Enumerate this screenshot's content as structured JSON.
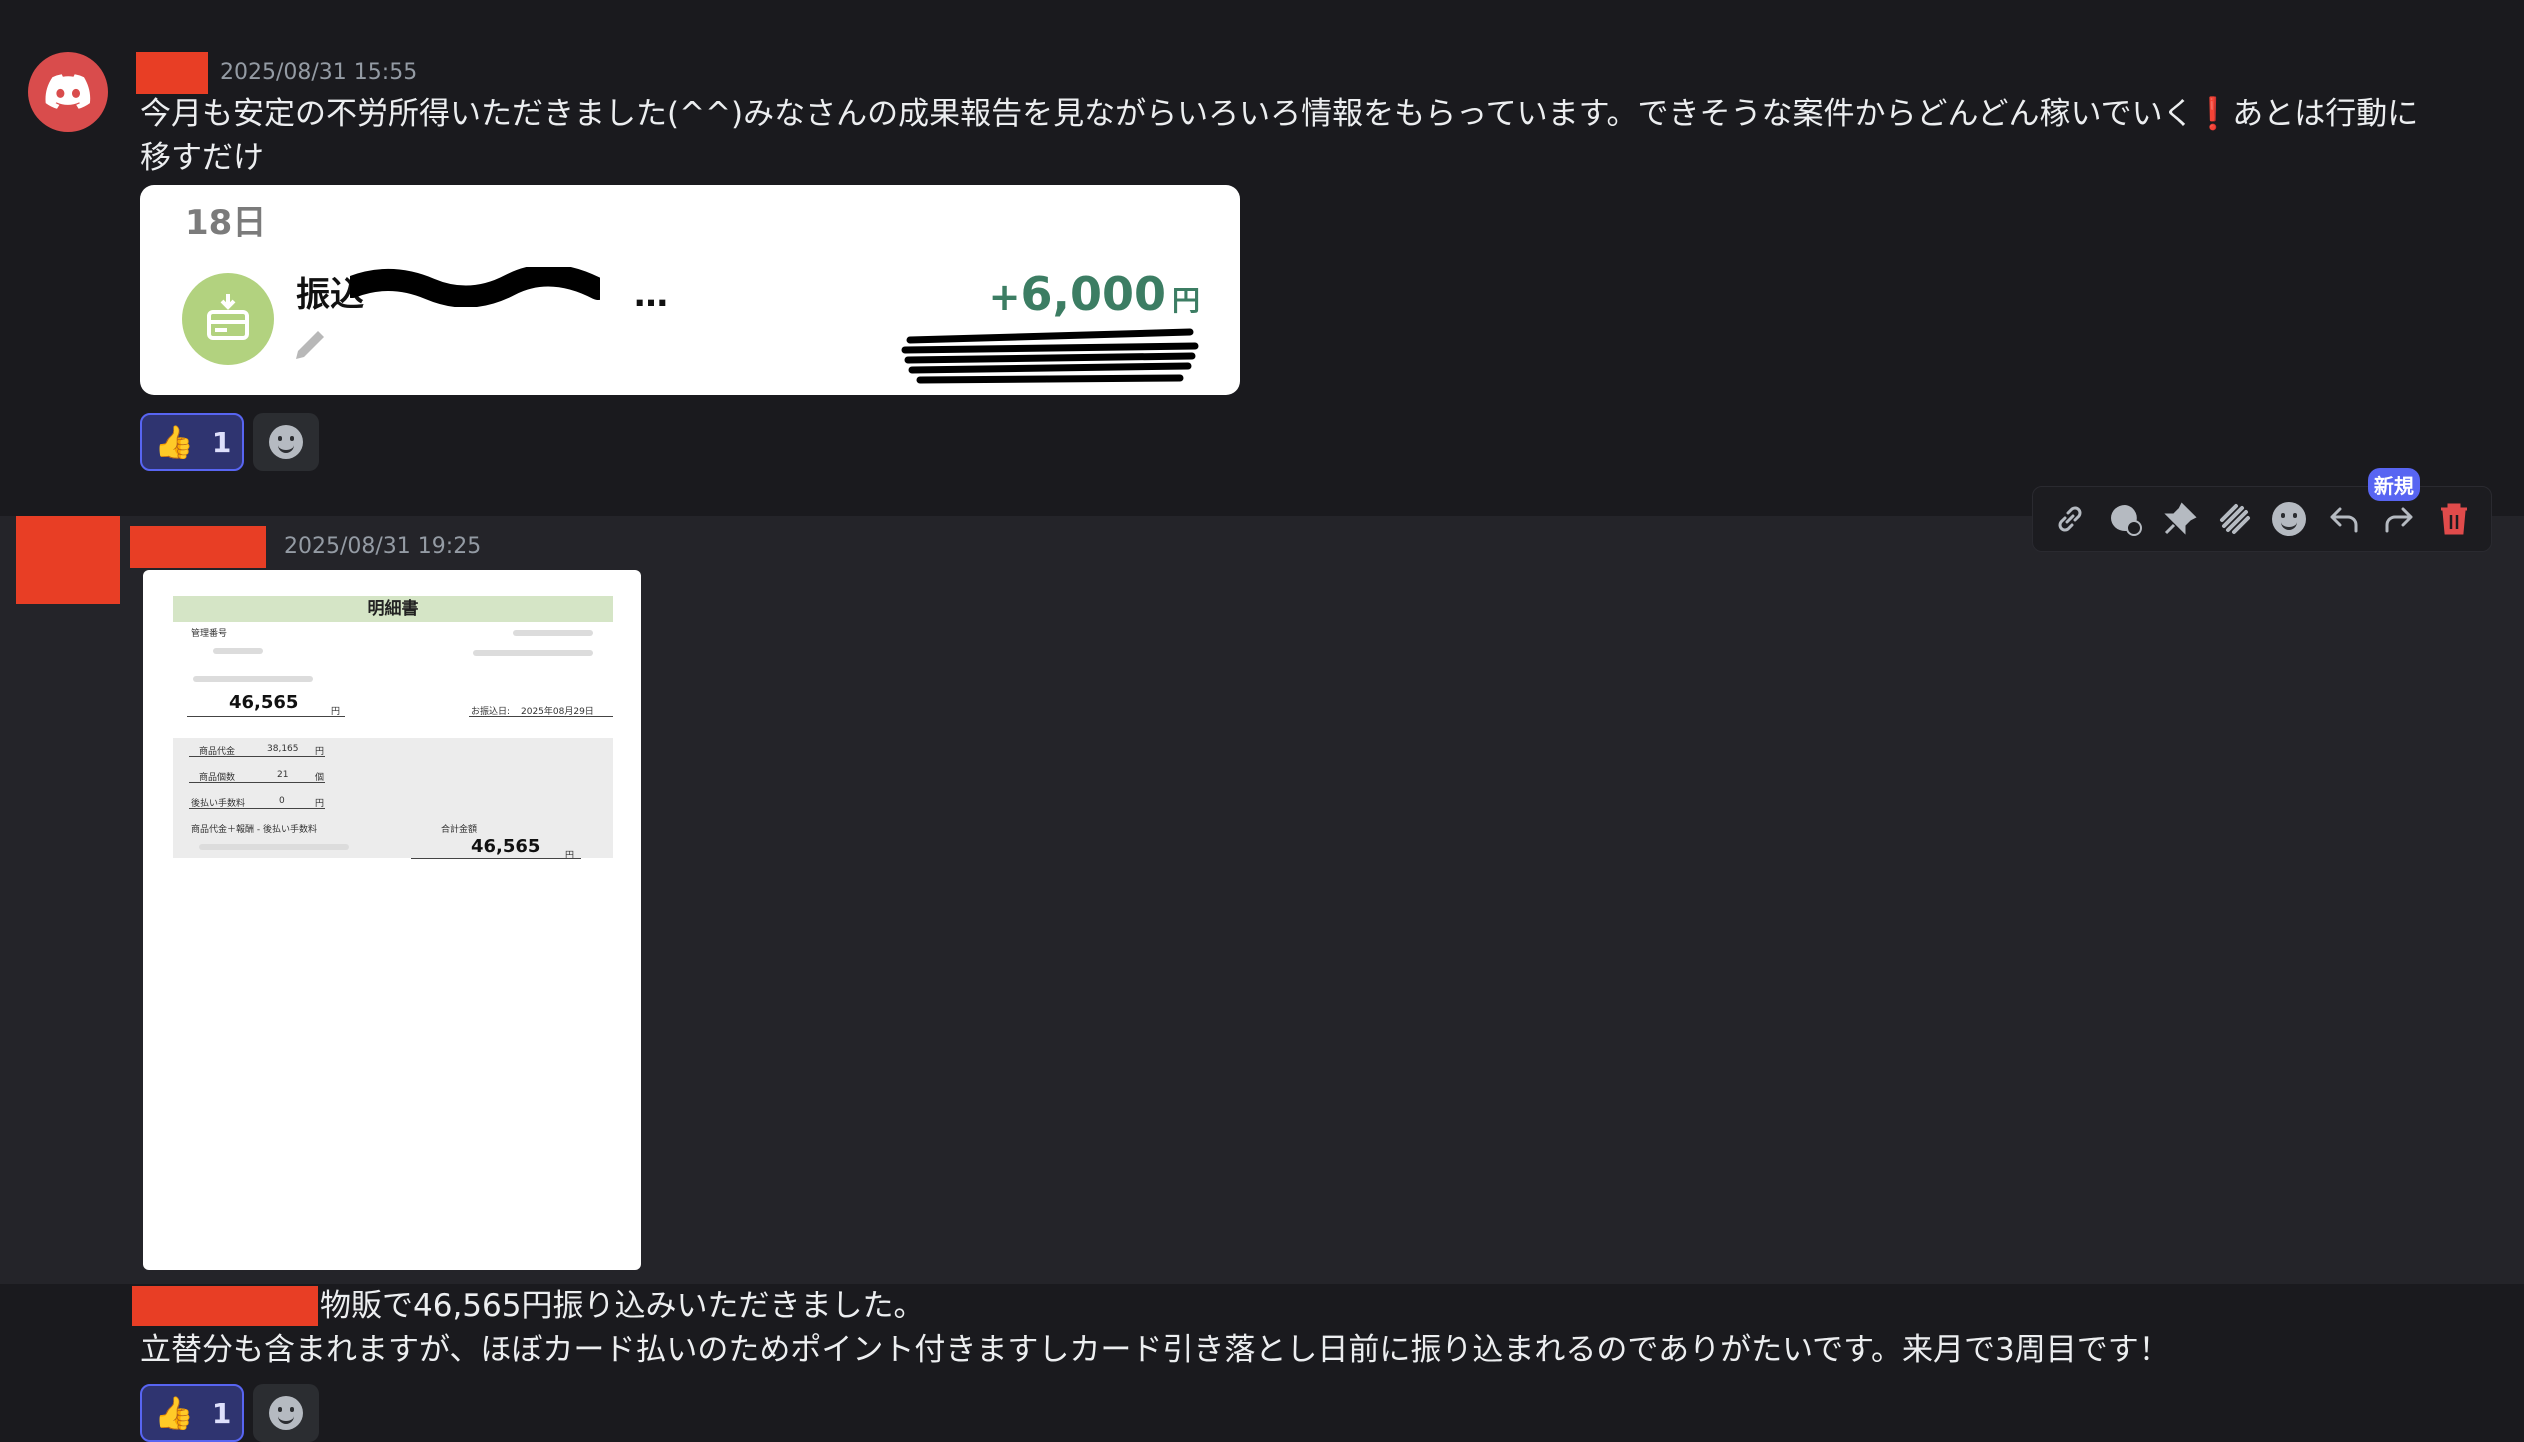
{
  "message1": {
    "timestamp": "2025/08/31 15:55",
    "text_part1": "今月も安定の不労所得いただきました(^^)みなさんの成果報告を見ながらいろいろ情報をもらっています。できそうな案件からどんどん稼いでいく",
    "exclamation": "❗",
    "text_part2": "あとは行動に",
    "text_line2": "移すだけ",
    "card": {
      "day": "18日",
      "title_visible": "振込",
      "title_trail": "…",
      "amount_sign": "+",
      "amount": "6,000",
      "currency": "円"
    },
    "reaction": {
      "emoji": "👍",
      "count": "1"
    }
  },
  "message2": {
    "timestamp": "2025/08/31 19:25",
    "receipt": {
      "title": "明細書",
      "mgmt_label": "管理番号",
      "total_top": "46,565",
      "yen": "円",
      "transfer_label": "お振込日:",
      "transfer_date": "2025年08月29日",
      "row1_label": "商品代金",
      "row1_value": "38,165",
      "row1_unit": "円",
      "row2_label": "商品個数",
      "row2_value": "21",
      "row2_unit": "個",
      "row3_label": "後払い手数料",
      "row3_value": "0",
      "row3_unit": "円",
      "bottom_label": "商品代金＋報酬 - 後払い手数料",
      "sum_label": "合計金額",
      "total_bottom": "46,565"
    },
    "toolbar": {
      "new_badge": "新規"
    }
  },
  "message3": {
    "line1": "物販で46,565円振り込みいただきました。",
    "line2": "立替分も含まれますが、ほぼカード払いのためポイント付きますしカード引き落とし日前に振り込まれるのでありがたいです。来月で3周目です！",
    "reaction": {
      "emoji": "👍",
      "count": "1"
    }
  }
}
